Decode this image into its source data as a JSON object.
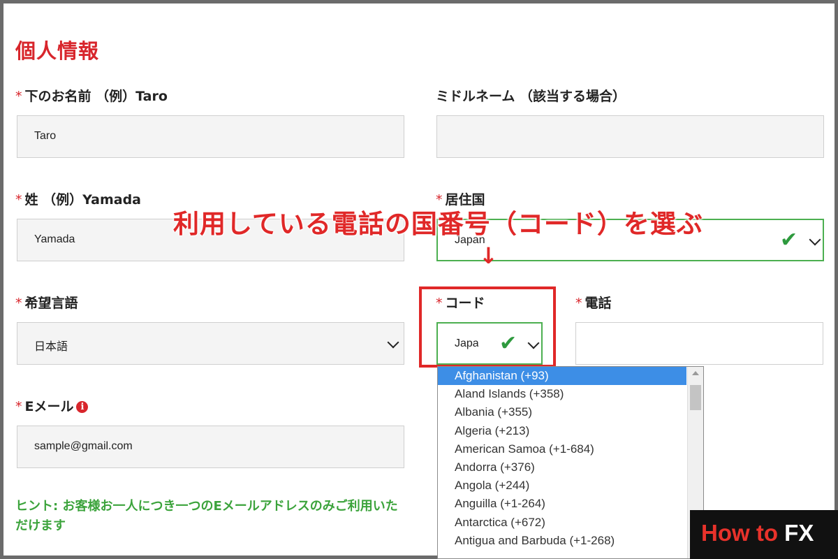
{
  "section_title": "個人情報",
  "fields": {
    "first_name": {
      "label": "下のお名前 （例）Taro",
      "value": "Taro",
      "required": "*"
    },
    "middle_name": {
      "label": "ミドルネーム （該当する場合）",
      "value": ""
    },
    "last_name": {
      "label": "姓 （例）Yamada",
      "value": "Yamada",
      "required": "*"
    },
    "country": {
      "label": "居住国",
      "value": "Japan",
      "required": "*"
    },
    "language": {
      "label": "希望言語",
      "value": "日本語",
      "required": "*"
    },
    "code": {
      "label": "コード",
      "value": "Japa",
      "required": "*"
    },
    "phone": {
      "label": "電話",
      "value": "",
      "required": "*"
    },
    "email": {
      "label": "Eメール",
      "value": "sample@gmail.com",
      "required": "*"
    }
  },
  "hint": "ヒント: お客様お一人につき一つのEメールアドレスのみご利用いただけます",
  "annotation": "利用している電話の国番号（コード）を選ぶ",
  "code_options": [
    "Afghanistan (+93)",
    "Aland Islands (+358)",
    "Albania (+355)",
    "Algeria (+213)",
    "American Samoa (+1-684)",
    "Andorra (+376)",
    "Angola (+244)",
    "Anguilla (+1-264)",
    "Antarctica (+672)",
    "Antigua and Barbuda (+1-268)"
  ],
  "brand": {
    "part1": "How to ",
    "part2": "FX"
  },
  "colors": {
    "accent_red": "#d8262c",
    "valid_green": "#4caf50",
    "hint_green": "#3ba33b",
    "selected_blue": "#3d8ee6"
  },
  "icons": {
    "valid": "check-icon",
    "dropdown": "chevron-down-icon",
    "info": "info-icon"
  }
}
